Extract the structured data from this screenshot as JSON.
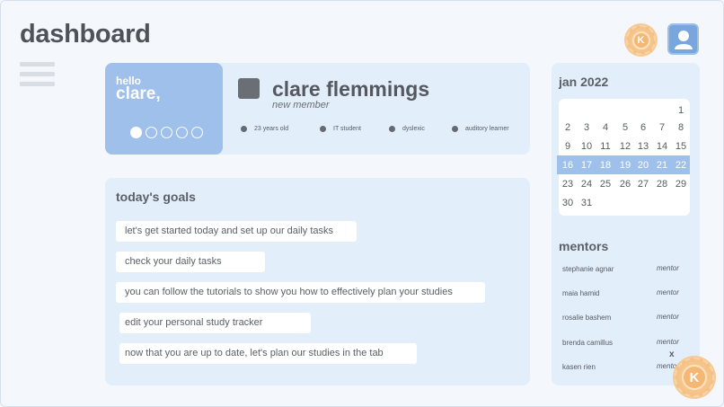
{
  "header": {
    "title": "dashboard",
    "coin_letter": "K"
  },
  "profile": {
    "greeting_small": "hello",
    "greeting_name": "clare,",
    "carousel": {
      "total": 5,
      "active_index": 0
    },
    "full_name": "clare flemmings",
    "role": "new member",
    "tags": [
      "23 years old",
      "IT student",
      "dyslexic",
      "auditory learner"
    ]
  },
  "goals": {
    "title": "today's goals",
    "items": [
      "let's get started today and set up our daily tasks",
      "check your daily tasks",
      "you can follow the tutorials to show you how to effectively plan your studies",
      "edit your personal study tracker",
      "now that you are up to date, let's plan our studies in the tab"
    ]
  },
  "calendar": {
    "month": "jan 2022",
    "rows": [
      [
        "",
        "",
        "",
        "",
        "",
        "",
        "1"
      ],
      [
        "2",
        "3",
        "4",
        "5",
        "6",
        "7",
        "8"
      ],
      [
        "9",
        "10",
        "11",
        "12",
        "13",
        "14",
        "15"
      ],
      [
        "16",
        "17",
        "18",
        "19",
        "20",
        "21",
        "22"
      ],
      [
        "23",
        "24",
        "25",
        "26",
        "27",
        "28",
        "29"
      ],
      [
        "30",
        "31",
        "",
        "",
        "",
        "",
        ""
      ]
    ],
    "highlighted_row": 3
  },
  "mentors": {
    "title": "mentors",
    "close_label": "x",
    "items": [
      {
        "name": "stephanie agnar",
        "role": "mentor"
      },
      {
        "name": "maia hamid",
        "role": "mentor"
      },
      {
        "name": "rosalie bashem",
        "role": "mentor"
      },
      {
        "name": "brenda camillus",
        "role": "mentor"
      },
      {
        "name": "kasen rien",
        "role": "mentor"
      }
    ]
  },
  "colors": {
    "accent": "#9fc0ea",
    "card": "#e3eefb",
    "background": "#f4f8fd",
    "coin": "#f5b874"
  }
}
